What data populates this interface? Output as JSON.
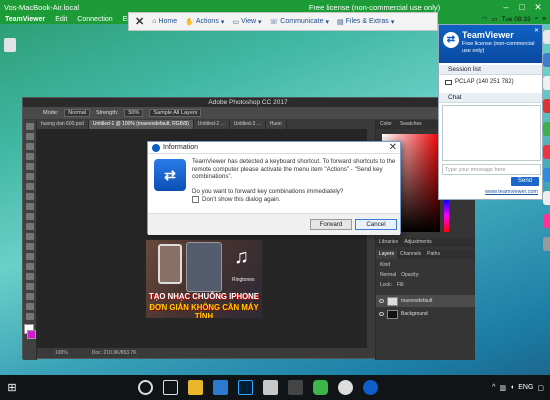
{
  "teamviewer_bar": {
    "title": "Vos-MacBook-Air.local",
    "license": "Free license (non-commercial use only)"
  },
  "mac_menu": {
    "items": [
      "TeamViewer",
      "Edit",
      "Connection",
      "Extras"
    ],
    "clock": "Tue 08:33"
  },
  "toolbar": {
    "home": "Home",
    "actions": "Actions",
    "view": "View",
    "communicate": "Communicate",
    "files": "Files & Extras"
  },
  "photoshop": {
    "title": "Adobe Photoshop CC 2017",
    "mode_label": "Mode:",
    "mode_value": "Normal",
    "strength_label": "Strength:",
    "strength_value": "50%",
    "sample_all": "Sample All Layers",
    "tabs": [
      "huong dan 600.psd",
      "Untitled-1 @ 100% (maxresdefault, RGB/8)",
      "Untitled-2 ...",
      "Untitled-3 ...",
      "Huon"
    ],
    "status_zoom": "100%",
    "status_doc": "Doc: 210.9K/853.7K",
    "color_tabs": [
      "Color",
      "Swatches"
    ],
    "library_tabs": [
      "Libraries",
      "Adjustments"
    ],
    "layer_tabs": [
      "Layers",
      "Channels",
      "Paths"
    ],
    "kind_label": "Kind",
    "blend_mode": "Normal",
    "opacity_label": "Opacity:",
    "lock_label": "Lock:",
    "fill_label": "Fill:",
    "layers": [
      "maxresdefault",
      "Background"
    ],
    "image_line1": "TẠO NHẠC CHUÔNG IPHONE",
    "image_line2": "ĐƠN GIẢN KHÔNG CẦN MÁY TÍNH",
    "image_sub": "Ringtones"
  },
  "dialog": {
    "title": "Information",
    "message": "TeamViewer has detected a keyboard shortcut. To forward shortcuts to the remote computer please activate the menu item \"Actions\" - \"Send key combinations\".",
    "question": "Do you want to forward key combinations immediately?",
    "checkbox": "Don't show this dialog again.",
    "forward": "Forward",
    "cancel": "Cancel"
  },
  "tv_panel": {
    "name": "TeamViewer",
    "license": "Free license (non-commercial use only)",
    "session_list": "Session list",
    "pc": "PCLAP (140 251 782)",
    "chat": "Chat",
    "chat_placeholder": "Type your message here",
    "send": "Send",
    "link": "www.teamviewer.com"
  },
  "taskbar": {
    "lang": "ENG"
  },
  "colors": {
    "tv_green": "#1d9b37",
    "tv_blue": "#0e5ec9",
    "ps_dark": "#3a3a3a"
  }
}
